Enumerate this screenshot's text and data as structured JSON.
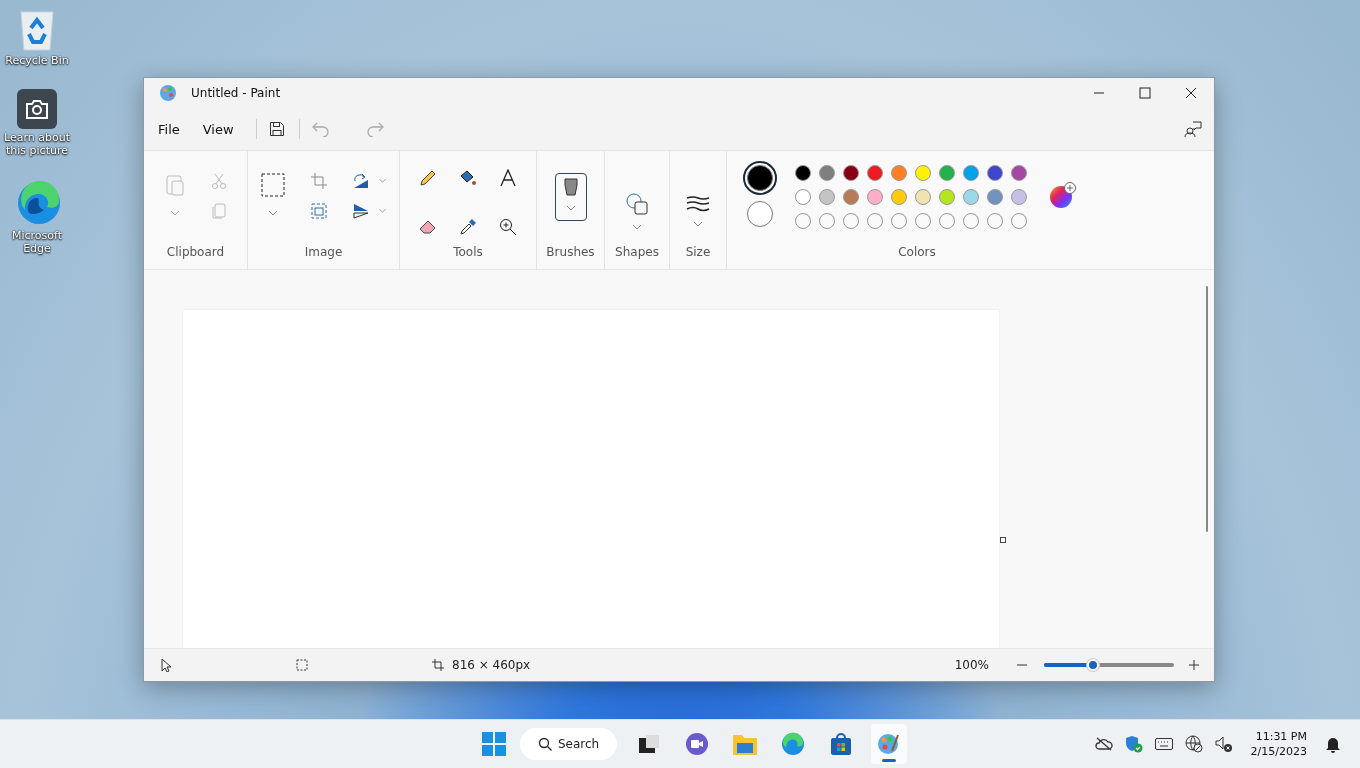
{
  "desktop_icons": [
    {
      "label": "Recycle Bin",
      "kind": "recycle"
    },
    {
      "label": "Learn about this picture",
      "kind": "camera"
    },
    {
      "label": "Microsoft Edge",
      "kind": "edge"
    }
  ],
  "window": {
    "title": "Untitled - Paint"
  },
  "menu": [
    "File",
    "View"
  ],
  "ribbon_groups": [
    "Clipboard",
    "Image",
    "Tools",
    "Brushes",
    "Shapes",
    "Size",
    "Colors"
  ],
  "color_slots": [
    {
      "color": "#000000",
      "selected": true
    },
    {
      "color": "#ffffff",
      "selected": false
    }
  ],
  "palette": [
    {
      "color": "#000000"
    },
    {
      "color": "#7f7f7f"
    },
    {
      "color": "#880015"
    },
    {
      "color": "#ed1c24"
    },
    {
      "color": "#ff7f27"
    },
    {
      "color": "#fff200"
    },
    {
      "color": "#22b14c"
    },
    {
      "color": "#00a2e8"
    },
    {
      "color": "#3f48cc"
    },
    {
      "color": "#a349a4"
    },
    {
      "color": "#ffffff"
    },
    {
      "color": "#c3c3c3"
    },
    {
      "color": "#b97a57"
    },
    {
      "color": "#ffaec9"
    },
    {
      "color": "#ffc90e"
    },
    {
      "color": "#efe4b0"
    },
    {
      "color": "#b5e61d"
    },
    {
      "color": "#99d9ea"
    },
    {
      "color": "#7092be"
    },
    {
      "color": "#c8bfe7"
    }
  ],
  "status_bar": {
    "canvas_size": "816 × 460px",
    "zoom": "100%",
    "zoom_slider": {
      "level": 0.38
    }
  },
  "taskbar": {
    "search": "Search",
    "apps": [
      {
        "kind": "taskview",
        "selected": false
      },
      {
        "kind": "chat",
        "selected": false
      },
      {
        "kind": "explorer",
        "selected": false
      },
      {
        "kind": "edge",
        "selected": false
      },
      {
        "kind": "store",
        "selected": false
      },
      {
        "kind": "paint",
        "selected": true
      }
    ],
    "time": "11:31 PM",
    "date": "2/15/2023"
  }
}
